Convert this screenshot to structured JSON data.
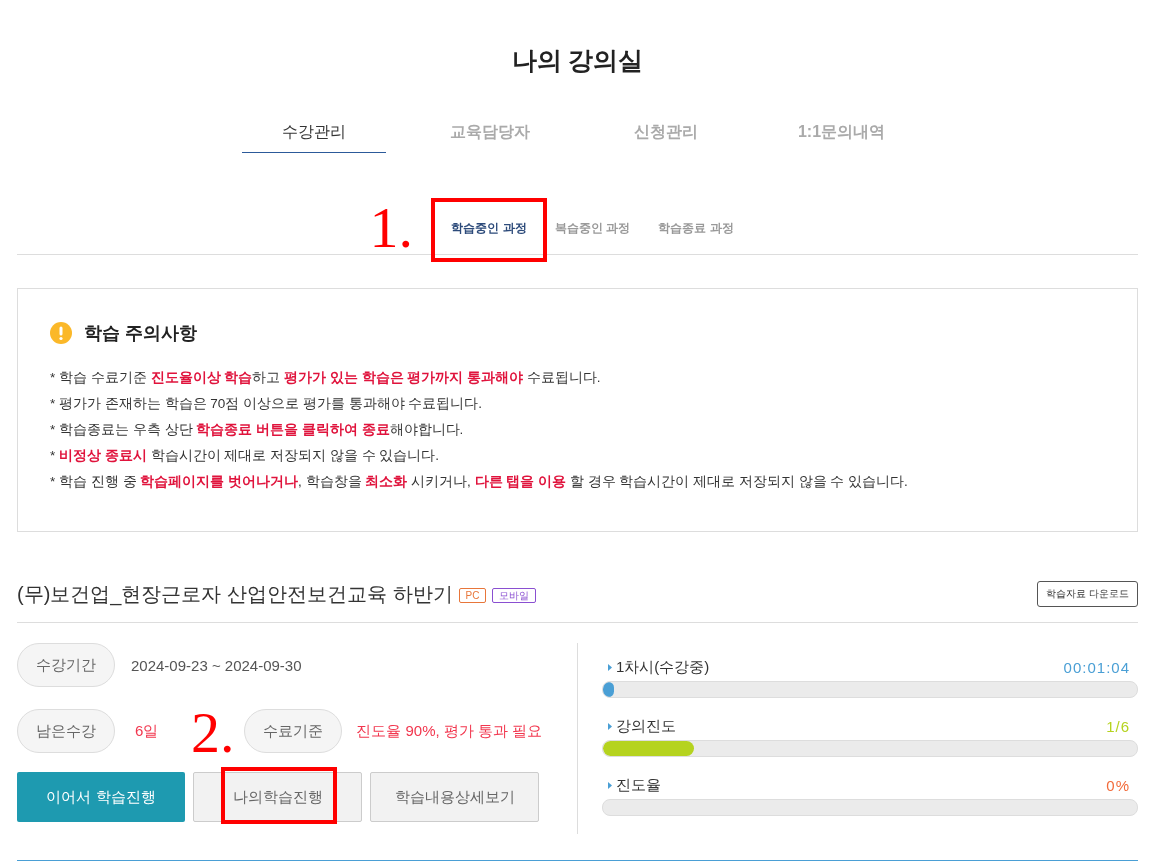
{
  "page_title": "나의 강의실",
  "main_tabs": [
    {
      "label": "수강관리",
      "selected": true
    },
    {
      "label": "교육담당자",
      "selected": false
    },
    {
      "label": "신청관리",
      "selected": false
    },
    {
      "label": "1:1문의내역",
      "selected": false
    }
  ],
  "sub_tabs": [
    {
      "label": "학습중인 과정",
      "selected": true,
      "annotation": "1."
    },
    {
      "label": "복습중인 과정",
      "selected": false
    },
    {
      "label": "학습종료 과정",
      "selected": false
    }
  ],
  "notice": {
    "title": "학습 주의사항",
    "lines": [
      "* 학습 수료기준 **진도율이상 학습**하고 **평가가 있는 학습은 평가까지 통과해야** 수료됩니다.",
      "* 평가가 존재하는 학습은 70점 이상으로 평가를 통과해야 수료됩니다.",
      "* 학습종료는 우측 상단 **학습종료 버튼을 클릭하여 종료**해야합니다.",
      "* **비정상 종료시** 학습시간이 제대로 저장되지 않을 수 있습니다.",
      "* 학습 진행 중 **학습페이지를 벗어나거나**, 학습창을 **최소화** 시키거나, **다른 탭을 이용** 할 경우 학습시간이 제대로 저장되지 않을 수 있습니다."
    ]
  },
  "course": {
    "title": "(무)보건업_현장근로자 산업안전보건교육 하반기",
    "badges": [
      {
        "label": "PC",
        "color": "#e8763a"
      },
      {
        "label": "모바일",
        "color": "#8a4fd1"
      }
    ],
    "download_button": "학습자료 다운로드",
    "period": {
      "label": "수강기간",
      "value": "2024-09-23 ~ 2024-09-30"
    },
    "remaining": {
      "label": "남은수강",
      "value": "6일"
    },
    "criteria": {
      "label": "수료기준",
      "value": "진도율 90%, 평가 통과 필요"
    },
    "buttons": [
      {
        "label": "이어서 학습진행",
        "kind": "primary"
      },
      {
        "label": "나의학습진행",
        "kind": "secondary",
        "annotation": "2."
      },
      {
        "label": "학습내용상세보기",
        "kind": "secondary"
      }
    ],
    "progress": [
      {
        "label": "1차시(수강중)",
        "value": "00:01:04",
        "level": 0.02,
        "color": "#4a9fd5"
      },
      {
        "label": "강의진도",
        "value": "1/6",
        "level": 0.17,
        "color": "#b5d31f"
      },
      {
        "label": "진도율",
        "value": "0%",
        "color": "#f26b3a"
      }
    ]
  }
}
